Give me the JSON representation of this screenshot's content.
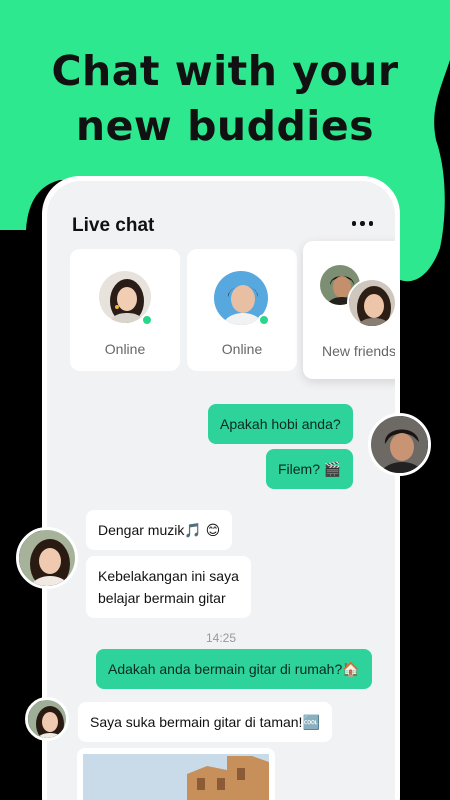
{
  "headline": {
    "line1": "Chat with your",
    "line2": "new buddies"
  },
  "colors": {
    "accent": "#2ee88f",
    "bubble_out": "#2dd39a",
    "background": "#000000",
    "screen": "#f1f2f4"
  },
  "chat": {
    "title": "Live chat",
    "menu_icon": "more-horizontal-icon",
    "cards": [
      {
        "label": "Online"
      },
      {
        "label": "Online"
      },
      {
        "label": "New friends"
      }
    ],
    "messages": [
      {
        "text": "Apakah hobi anda?"
      },
      {
        "text": "Filem? 🎬"
      },
      {
        "text": "Dengar muzik🎵 😊"
      },
      {
        "line1": "Kebelakangan ini saya",
        "line2": "belajar bermain gitar"
      },
      {
        "text": "Adakah anda bermain gitar di rumah?🏠"
      },
      {
        "text": "Saya suka bermain gitar di taman!🆒"
      }
    ],
    "timestamp": "14:25"
  }
}
